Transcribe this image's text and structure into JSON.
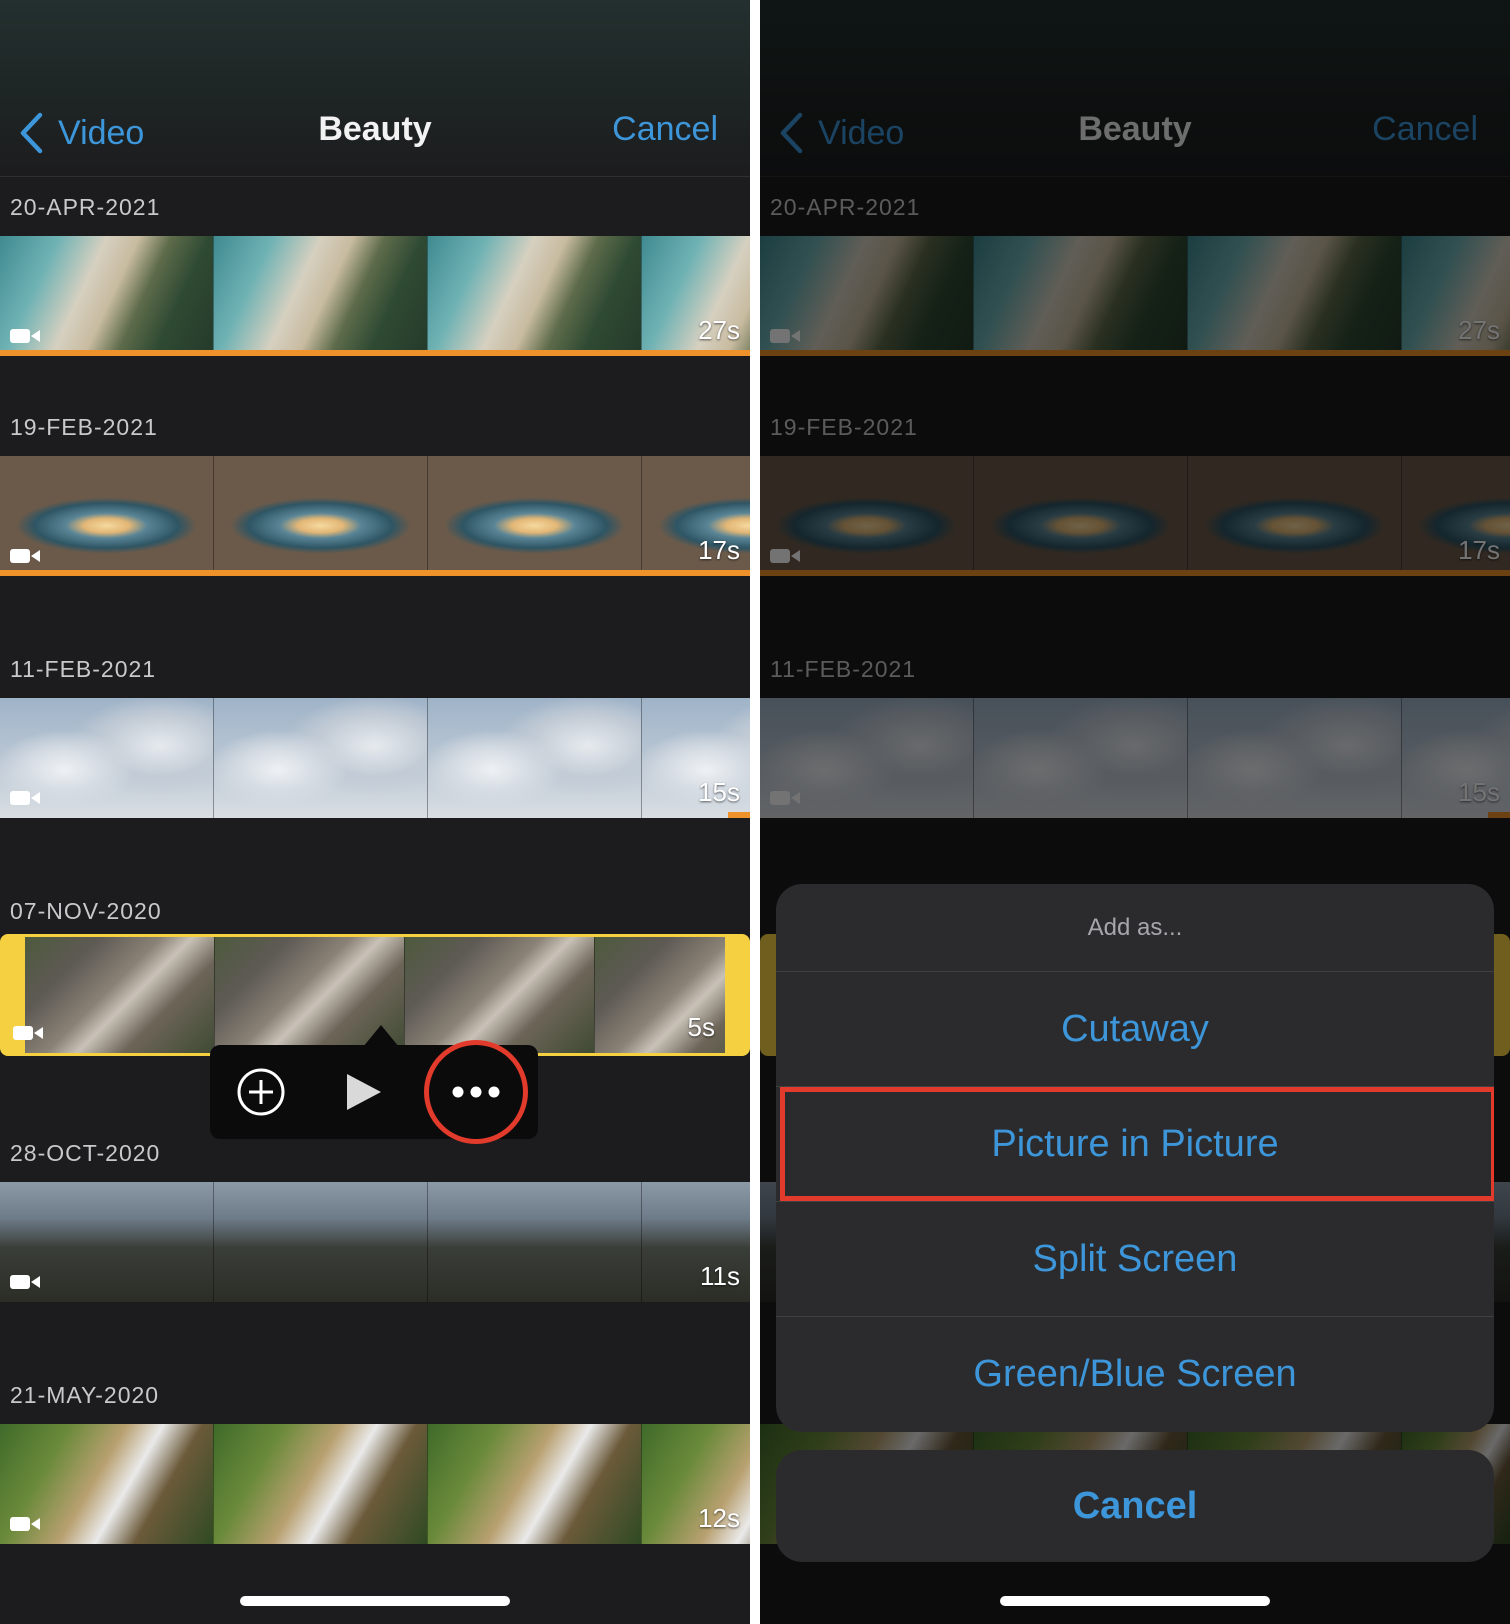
{
  "navbar": {
    "back_label": "Video",
    "title": "Beauty",
    "cancel_label": "Cancel"
  },
  "clips": [
    {
      "date": "20-APR-2021",
      "duration": "27s",
      "theme": "beach",
      "progress": 1.0
    },
    {
      "date": "19-FEB-2021",
      "duration": "17s",
      "theme": "record",
      "progress": 1.0
    },
    {
      "date": "11-FEB-2021",
      "duration": "15s",
      "theme": "clouds",
      "progress": 0.03
    },
    {
      "date": "07-NOV-2020",
      "duration": "5s",
      "theme": "city",
      "selected": true
    },
    {
      "date": "28-OCT-2020",
      "duration": "11s",
      "theme": "fog"
    },
    {
      "date": "21-MAY-2020",
      "duration": "12s",
      "theme": "bees"
    }
  ],
  "popover": {
    "add_icon": "plus-circle-icon",
    "play_icon": "play-icon",
    "more_icon": "ellipsis-icon"
  },
  "action_sheet": {
    "header": "Add as...",
    "options": [
      "Cutaway",
      "Picture in Picture",
      "Split Screen",
      "Green/Blue Screen"
    ],
    "highlighted": "Picture in Picture",
    "cancel_label": "Cancel"
  },
  "colors": {
    "accent": "#3d96d9",
    "highlight": "#e23b2c",
    "selection": "#f5d142",
    "progress": "#f0922b",
    "background": "#1c1c1e"
  }
}
